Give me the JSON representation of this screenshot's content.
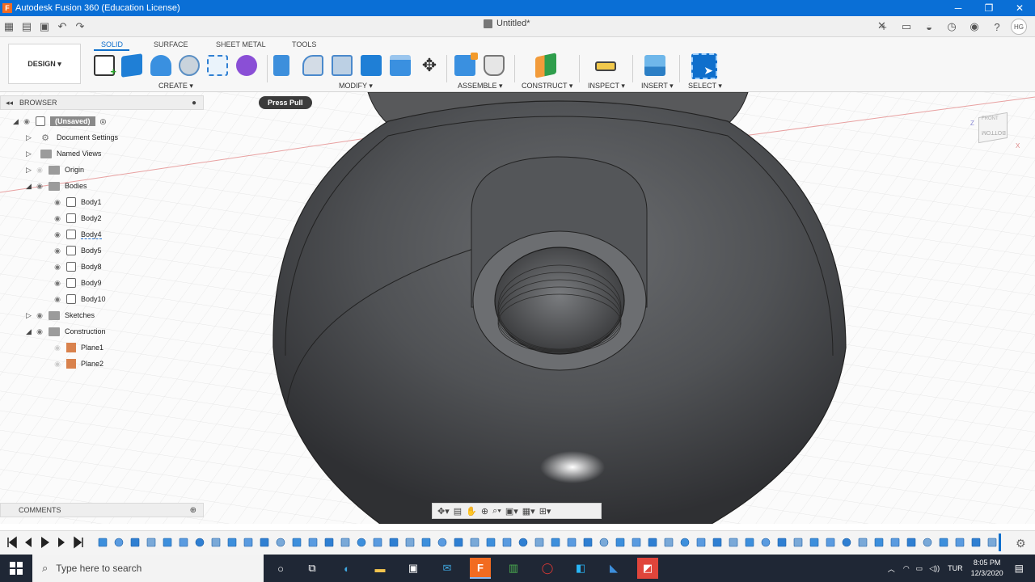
{
  "window": {
    "title": "Autodesk Fusion 360 (Education License)",
    "logo_letter": "F",
    "minimize": "─",
    "maximize": "❐",
    "close": "✕"
  },
  "document": {
    "tab_title": "Untitled*",
    "close": "✕"
  },
  "user_initials": "HG",
  "design_button": "DESIGN ▾",
  "workspace_tabs": [
    "SOLID",
    "SURFACE",
    "SHEET METAL",
    "TOOLS"
  ],
  "groups": [
    "CREATE ▾",
    "MODIFY ▾",
    "ASSEMBLE ▾",
    "CONSTRUCT ▾",
    "INSPECT ▾",
    "INSERT ▾",
    "SELECT ▾"
  ],
  "tooltip": "Press Pull",
  "browser": {
    "title": "BROWSER",
    "root": "(Unsaved)",
    "items": [
      "Document Settings",
      "Named Views",
      "Origin",
      "Bodies"
    ],
    "bodies": [
      "Body1",
      "Body2",
      "Body4",
      "Body5",
      "Body8",
      "Body9",
      "Body10"
    ],
    "sketches": "Sketches",
    "construction": "Construction",
    "planes": [
      "Plane1",
      "Plane2"
    ]
  },
  "viewcube": {
    "front": "FRONT",
    "bottom": "BOTTOM"
  },
  "comments": "COMMENTS",
  "taskbar": {
    "search_placeholder": "Type here to search",
    "language": "TUR",
    "time": "8:05 PM",
    "date": "12/3/2020"
  },
  "colors": {
    "accent": "#0f6fcc",
    "titlebar": "#0a6fd6",
    "taskbar": "#1f2735",
    "model": "#4a4c4f"
  }
}
